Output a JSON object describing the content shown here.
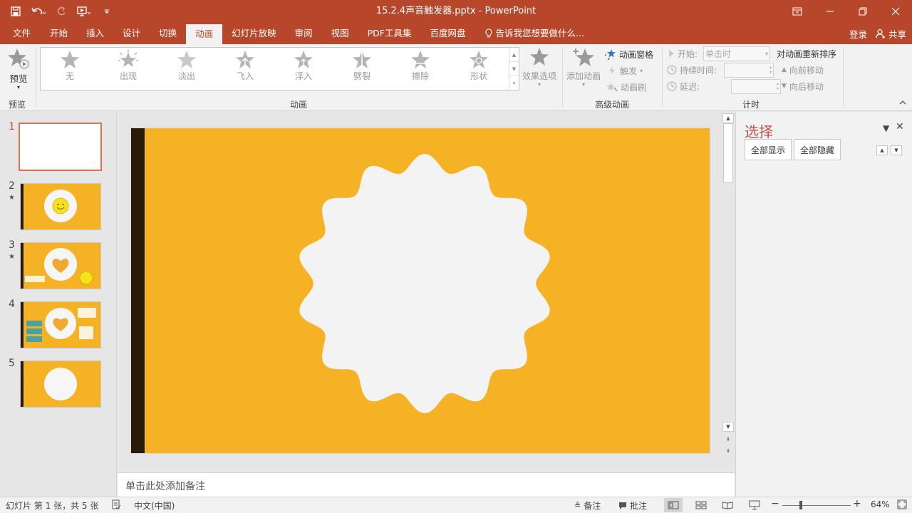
{
  "window": {
    "title": "15.2.4声音触发器.pptx - PowerPoint"
  },
  "tabs": [
    "文件",
    "开始",
    "插入",
    "设计",
    "切换",
    "动画",
    "幻灯片放映",
    "审阅",
    "视图",
    "PDF工具集",
    "百度网盘"
  ],
  "active_tab": "动画",
  "tell_me": "告诉我您想要做什么...",
  "account": {
    "login": "登录",
    "share": "共享"
  },
  "ribbon": {
    "preview": {
      "button": "预览",
      "group": "预览"
    },
    "animation_gallery": {
      "items": [
        "无",
        "出现",
        "淡出",
        "飞入",
        "浮入",
        "劈裂",
        "擦除",
        "形状"
      ],
      "effect_options": "效果选项",
      "group": "动画"
    },
    "advanced": {
      "add_animation": "添加动画",
      "animation_pane": "动画窗格",
      "trigger": "触发",
      "painter": "动画刷",
      "group": "高级动画"
    },
    "timing": {
      "start_label": "开始:",
      "start_value": "单击时",
      "duration_label": "持续时间:",
      "delay_label": "延迟:",
      "reorder_title": "对动画重新排序",
      "move_earlier": "向前移动",
      "move_later": "向后移动",
      "group": "计时"
    }
  },
  "slides": [
    {
      "num": "1",
      "has_animation": false
    },
    {
      "num": "2",
      "has_animation": true
    },
    {
      "num": "3",
      "has_animation": true
    },
    {
      "num": "4",
      "has_animation": false
    },
    {
      "num": "5",
      "has_animation": false
    }
  ],
  "slide_colors": {
    "background": "#f5b224",
    "bar": "#2a1a08",
    "badge": "#f3f3f3"
  },
  "notes_placeholder": "单击此处添加备注",
  "selection_pane": {
    "title": "选择",
    "show_all": "全部显示",
    "hide_all": "全部隐藏"
  },
  "status": {
    "slide_info": "幻灯片 第 1 张，共 5 张",
    "language": "中文(中国)",
    "notes": "备注",
    "comments": "批注",
    "zoom": "64%"
  }
}
